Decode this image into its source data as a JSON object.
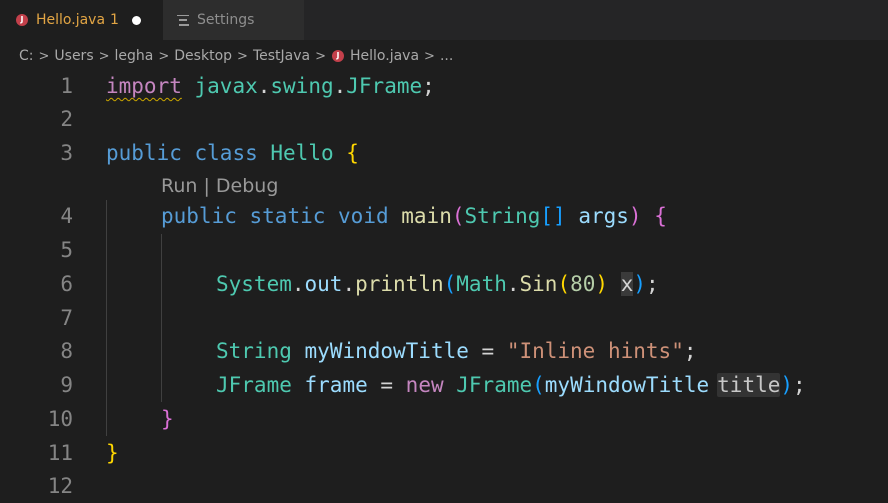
{
  "tabs": [
    {
      "label": "Hello.java",
      "badge": "1",
      "icon": "java-icon",
      "dirty": true,
      "active": true
    },
    {
      "label": "Settings",
      "icon": "settings-icon",
      "active": false
    }
  ],
  "breadcrumb": [
    "C:",
    "Users",
    "legha",
    "Desktop",
    "TestJava",
    "Hello.java",
    "..."
  ],
  "codelens": "Run | Debug",
  "lines": [
    {
      "n": "1",
      "t": {
        "a": "import",
        "b": " ",
        "c": "javax",
        "d": ".",
        "e": "swing",
        "f": ".",
        "g": "JFrame",
        "h": ";"
      }
    },
    {
      "n": "2"
    },
    {
      "n": "3",
      "t": {
        "a": "public",
        "b": " ",
        "c": "class",
        "d": " ",
        "e": "Hello",
        "f": " ",
        "g": "{"
      }
    },
    {
      "n": "4",
      "t": {
        "a": "public",
        "b": " ",
        "c": "static",
        "d": " ",
        "e": "void",
        "f": " ",
        "g": "main",
        "h": "(",
        "i": "String",
        "j": "[]",
        "k": " ",
        "l": "args",
        "m": ")",
        "n2": " ",
        "o": "{"
      }
    },
    {
      "n": "5"
    },
    {
      "n": "6",
      "t": {
        "a": "System",
        "b": ".",
        "c": "out",
        "d": ".",
        "e": "println",
        "f": "(",
        "g": "Math",
        "h": ".",
        "i": "Sin",
        "j": "(",
        "k": "80",
        "l": ")",
        "m": " ",
        "n2": "x",
        "o": ")",
        "p": ";"
      }
    },
    {
      "n": "7"
    },
    {
      "n": "8",
      "t": {
        "a": "String",
        "b": " ",
        "c": "myWindowTitle",
        "d": " = ",
        "e": "\"Inline hints\"",
        "f": ";"
      }
    },
    {
      "n": "9",
      "t": {
        "a": "JFrame",
        "b": " ",
        "c": "frame",
        "d": " = ",
        "e": "new",
        "f": " ",
        "g": "JFrame",
        "h": "(",
        "i": "myWindowTitle",
        "j": "title",
        "k": ")",
        "l": ";"
      }
    },
    {
      "n": "10",
      "t": {
        "a": "}"
      }
    },
    {
      "n": "11",
      "t": {
        "a": "}"
      }
    },
    {
      "n": "12"
    }
  ],
  "colors": {
    "background": "#1e1e1e",
    "tab_bar": "#252526",
    "keyword": "#569cd6",
    "type": "#4ec9b0",
    "function": "#dcdcaa",
    "variable": "#9cdcfe",
    "string": "#ce9178",
    "number": "#b5cea8",
    "control_keyword": "#c586c0",
    "bracket_1": "#ffd700",
    "bracket_2": "#da70d6",
    "bracket_3": "#179fff",
    "warning": "#cca700"
  }
}
